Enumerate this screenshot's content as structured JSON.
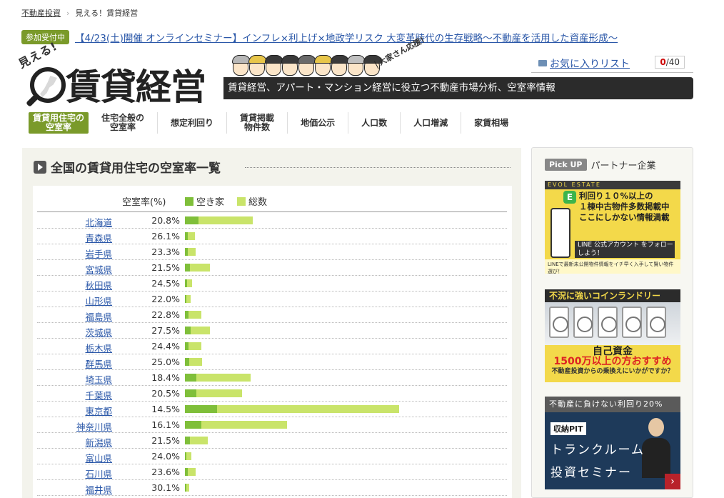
{
  "breadcrumb": {
    "home": "不動産投資",
    "current": "見える！賃貸経営"
  },
  "notice": {
    "badge": "参加受付中",
    "text": "【4/23(土)開催 オンラインセミナー】インフレ×利上げ×地政学リスク 大変革時代の生存戦略～不動産を活用した資産形成～"
  },
  "logo": {
    "small": "見える!",
    "big": "賃貸経営",
    "ouen": "大家さん応援！"
  },
  "tagline": "賃貸経営、アパート・マンション経営に役立つ不動産市場分析、空室率情報",
  "favorites": {
    "label": "お気に入りリスト",
    "count": "0",
    "max": "/40"
  },
  "nav": [
    {
      "label": "賃貸用住宅の\n空室率",
      "active": true
    },
    {
      "label": "住宅全般の\n空室率",
      "active": false
    },
    {
      "label": "想定利回り",
      "active": false
    },
    {
      "label": "賃貸掲載\n物件数",
      "active": false
    },
    {
      "label": "地価公示",
      "active": false
    },
    {
      "label": "人口数",
      "active": false
    },
    {
      "label": "人口増減",
      "active": false
    },
    {
      "label": "家賃相場",
      "active": false
    }
  ],
  "section_title": "全国の賃貸用住宅の空室率一覧",
  "table": {
    "rate_header": "空室率(%)",
    "legend_vacant": "空き家",
    "legend_total": "総数",
    "colors": {
      "vacant": "#7fbf3a",
      "total": "#c9e46a"
    }
  },
  "chart_data": {
    "type": "bar",
    "categories": [
      "北海道",
      "青森県",
      "岩手県",
      "宮城県",
      "秋田県",
      "山形県",
      "福島県",
      "茨城県",
      "栃木県",
      "群馬県",
      "埼玉県",
      "千葉県",
      "東京都",
      "神奈川県",
      "新潟県",
      "富山県",
      "石川県",
      "福井県"
    ],
    "vacancy_rate": [
      "20.8%",
      "26.1%",
      "23.3%",
      "21.5%",
      "24.5%",
      "22.0%",
      "22.8%",
      "27.5%",
      "24.4%",
      "25.0%",
      "18.4%",
      "20.5%",
      "14.5%",
      "16.1%",
      "21.5%",
      "24.0%",
      "23.6%",
      "30.1%"
    ],
    "series": [
      {
        "name": "空き家",
        "values": [
          19,
          4,
          4,
          7,
          3,
          2,
          5,
          8,
          5,
          6,
          16,
          16,
          45,
          23,
          7,
          2,
          4,
          2
        ]
      },
      {
        "name": "総数",
        "values": [
          95,
          14,
          15,
          35,
          10,
          8,
          23,
          35,
          23,
          24,
          92,
          80,
          300,
          143,
          32,
          9,
          15,
          6
        ]
      }
    ]
  },
  "sidebar": {
    "pick_badge": "Pick UP",
    "pick_title": "パートナー企業",
    "ad1": {
      "brand": "EVOL ESTATE",
      "line1": "利回り１０%以上の",
      "line2": "１棟中古物件多数掲載中",
      "line3": "ここにしかない情報満載",
      "dark": "LINE 公式アカウント をフォローしよう！",
      "foot": "LINEで最新未公開物件情報をイチ早く入手して賢い物件選び！"
    },
    "ad2": {
      "head": "不況に強いコインランドリー",
      "c1": "自己資金",
      "c2": "1500万以上の方おすすめ",
      "c3": "不動産投資からの乗換えにいかがですか？"
    },
    "ad3": {
      "head": "不動産に負けない利回り20%",
      "logo": "収納PIT",
      "t1": "トランクルーム",
      "t2": "投資セミナー",
      "arrow": "›"
    }
  }
}
